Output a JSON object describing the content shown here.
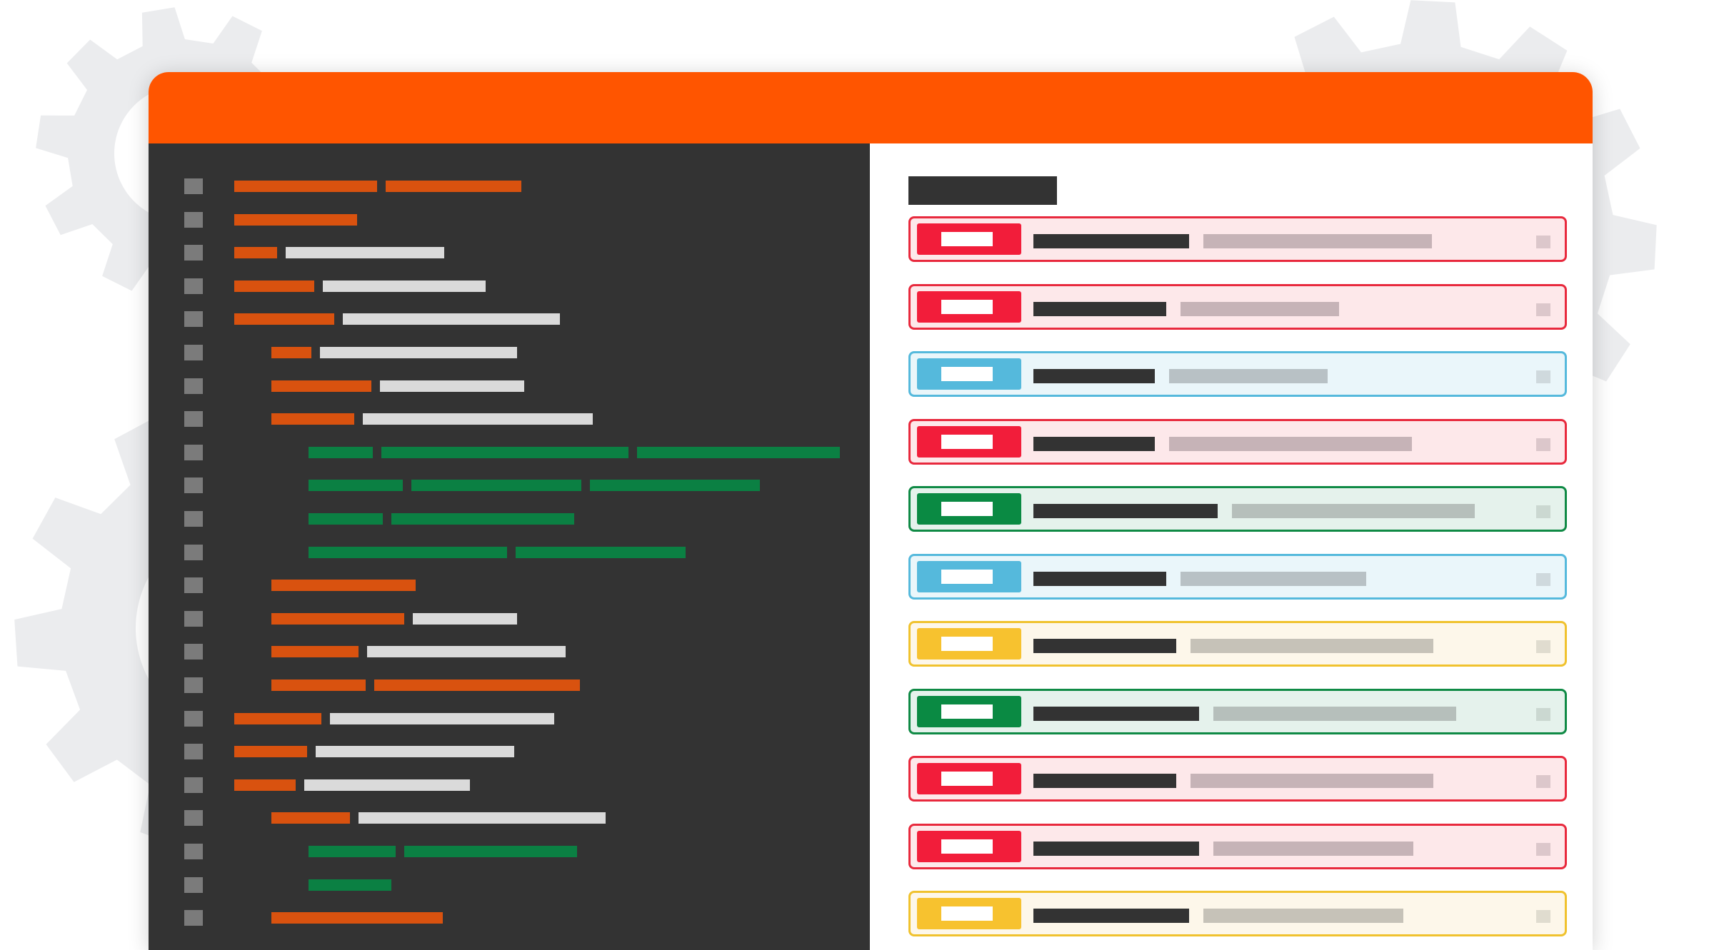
{
  "colors": {
    "page_background": "#ffffff",
    "gear": "#ebecee",
    "titlebar": "#ff5500",
    "editor_background": "#333333",
    "panel_background": "#ffffff",
    "gutter_marker": "#7b7b7b",
    "keyword": "#d9520f",
    "identifier": "#dadada",
    "string": "#0b8043",
    "heading_bar": "#333333",
    "title_bar": "#333333"
  },
  "editor": {
    "icons": [
      "gutter-marker"
    ],
    "lines": [
      {
        "indent": 0,
        "tokens": [
          {
            "kind": "keyword",
            "len": 200
          },
          {
            "kind": "keyword",
            "len": 190
          }
        ]
      },
      {
        "indent": 0,
        "tokens": [
          {
            "kind": "keyword",
            "len": 172
          }
        ]
      },
      {
        "indent": 0,
        "tokens": [
          {
            "kind": "keyword",
            "len": 60
          },
          {
            "kind": "identifier",
            "len": 222
          }
        ]
      },
      {
        "indent": 0,
        "tokens": [
          {
            "kind": "keyword",
            "len": 112
          },
          {
            "kind": "identifier",
            "len": 228
          }
        ]
      },
      {
        "indent": 0,
        "tokens": [
          {
            "kind": "keyword",
            "len": 140
          },
          {
            "kind": "identifier",
            "len": 304
          }
        ]
      },
      {
        "indent": 1,
        "tokens": [
          {
            "kind": "keyword",
            "len": 56
          },
          {
            "kind": "identifier",
            "len": 276
          }
        ]
      },
      {
        "indent": 1,
        "tokens": [
          {
            "kind": "keyword",
            "len": 140
          },
          {
            "kind": "identifier",
            "len": 202
          }
        ]
      },
      {
        "indent": 1,
        "tokens": [
          {
            "kind": "keyword",
            "len": 116
          },
          {
            "kind": "identifier",
            "len": 322
          }
        ]
      },
      {
        "indent": 2,
        "tokens": [
          {
            "kind": "string",
            "len": 90
          },
          {
            "kind": "string",
            "len": 346
          },
          {
            "kind": "string",
            "len": 284
          }
        ]
      },
      {
        "indent": 2,
        "tokens": [
          {
            "kind": "string",
            "len": 132
          },
          {
            "kind": "string",
            "len": 238
          },
          {
            "kind": "string",
            "len": 238
          }
        ]
      },
      {
        "indent": 2,
        "tokens": [
          {
            "kind": "string",
            "len": 104
          },
          {
            "kind": "string",
            "len": 256
          }
        ]
      },
      {
        "indent": 2,
        "tokens": [
          {
            "kind": "string",
            "len": 278
          },
          {
            "kind": "string",
            "len": 238
          }
        ]
      },
      {
        "indent": 1,
        "tokens": [
          {
            "kind": "keyword",
            "len": 202
          }
        ]
      },
      {
        "indent": 1,
        "tokens": [
          {
            "kind": "keyword",
            "len": 186
          },
          {
            "kind": "identifier",
            "len": 146
          }
        ]
      },
      {
        "indent": 1,
        "tokens": [
          {
            "kind": "keyword",
            "len": 122
          },
          {
            "kind": "identifier",
            "len": 278
          }
        ]
      },
      {
        "indent": 1,
        "tokens": [
          {
            "kind": "keyword",
            "len": 132
          },
          {
            "kind": "keyword",
            "len": 288
          }
        ]
      },
      {
        "indent": 0,
        "tokens": [
          {
            "kind": "keyword",
            "len": 122
          },
          {
            "kind": "identifier",
            "len": 314
          }
        ]
      },
      {
        "indent": 0,
        "tokens": [
          {
            "kind": "keyword",
            "len": 102
          },
          {
            "kind": "identifier",
            "len": 278
          }
        ]
      },
      {
        "indent": 0,
        "tokens": [
          {
            "kind": "keyword",
            "len": 86
          },
          {
            "kind": "identifier",
            "len": 232
          }
        ]
      },
      {
        "indent": 1,
        "tokens": [
          {
            "kind": "keyword",
            "len": 110
          },
          {
            "kind": "identifier",
            "len": 346
          }
        ]
      },
      {
        "indent": 2,
        "tokens": [
          {
            "kind": "string",
            "len": 122
          },
          {
            "kind": "string",
            "len": 242
          }
        ]
      },
      {
        "indent": 2,
        "tokens": [
          {
            "kind": "string",
            "len": 116
          }
        ]
      },
      {
        "indent": 1,
        "tokens": [
          {
            "kind": "keyword",
            "len": 240
          }
        ]
      }
    ]
  },
  "panel": {
    "icons": [
      "check-box"
    ],
    "statuses": {
      "error": {
        "border": "#e8293d",
        "fill": "#fde8ea",
        "badge": "#f21d3a",
        "desc": "#c6b3b7",
        "check": "#dcc7cb"
      },
      "info": {
        "border": "#55b9dc",
        "fill": "#eaf6fa",
        "badge": "#55b9dc",
        "desc": "#b8c1c5",
        "check": "#cfd9dd"
      },
      "success": {
        "border": "#0f8a45",
        "fill": "#e5f2ec",
        "badge": "#0a8a43",
        "desc": "#b6bfbb",
        "check": "#cbd8d1"
      },
      "warning": {
        "border": "#f0c22e",
        "fill": "#fdf7ea",
        "badge": "#f7c22f",
        "desc": "#c6c2b8",
        "check": "#e0dccf"
      }
    },
    "items": [
      {
        "status": "error",
        "title_len": 218,
        "desc_len": 320
      },
      {
        "status": "error",
        "title_len": 186,
        "desc_len": 222
      },
      {
        "status": "info",
        "title_len": 170,
        "desc_len": 222
      },
      {
        "status": "error",
        "title_len": 170,
        "desc_len": 340
      },
      {
        "status": "success",
        "title_len": 258,
        "desc_len": 340
      },
      {
        "status": "info",
        "title_len": 186,
        "desc_len": 260
      },
      {
        "status": "warning",
        "title_len": 200,
        "desc_len": 340
      },
      {
        "status": "success",
        "title_len": 232,
        "desc_len": 340
      },
      {
        "status": "error",
        "title_len": 200,
        "desc_len": 340
      },
      {
        "status": "error",
        "title_len": 232,
        "desc_len": 280
      },
      {
        "status": "warning",
        "title_len": 218,
        "desc_len": 280
      }
    ]
  }
}
